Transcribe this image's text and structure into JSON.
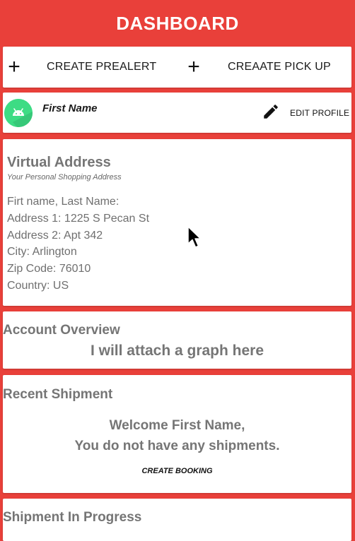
{
  "header": {
    "title": "DASHBOARD"
  },
  "actions": {
    "create_prealert": "CREATE PREALERT",
    "create_pickup": "CREAATE PICK UP"
  },
  "profile": {
    "name": "First Name",
    "edit_label": "EDIT PROFILE"
  },
  "virtual_address": {
    "title": "Virtual Address",
    "subtitle": "Your Personal Shopping Address",
    "lines": [
      "Firt name, Last Name:",
      "Address 1: 1225 S Pecan St",
      "Address 2: Apt 342",
      "City: Arlington",
      "Zip Code: 76010",
      "Country: US"
    ]
  },
  "overview": {
    "title": "Account Overview",
    "message": "I will attach a graph here"
  },
  "recent": {
    "title": "Recent Shipment",
    "welcome": "Welcome First Name,",
    "empty": "You do not have any shipments.",
    "create_booking": "CREATE BOOKING"
  },
  "in_progress": {
    "title": "Shipment In Progress"
  },
  "icons": {
    "plus": "plus-icon",
    "avatar": "android-icon",
    "edit": "pencil-icon",
    "cursor": "mouse-pointer"
  },
  "colors": {
    "primary": "#e9403a",
    "avatar_bg": "#3ddc84",
    "text_muted": "#757575"
  }
}
